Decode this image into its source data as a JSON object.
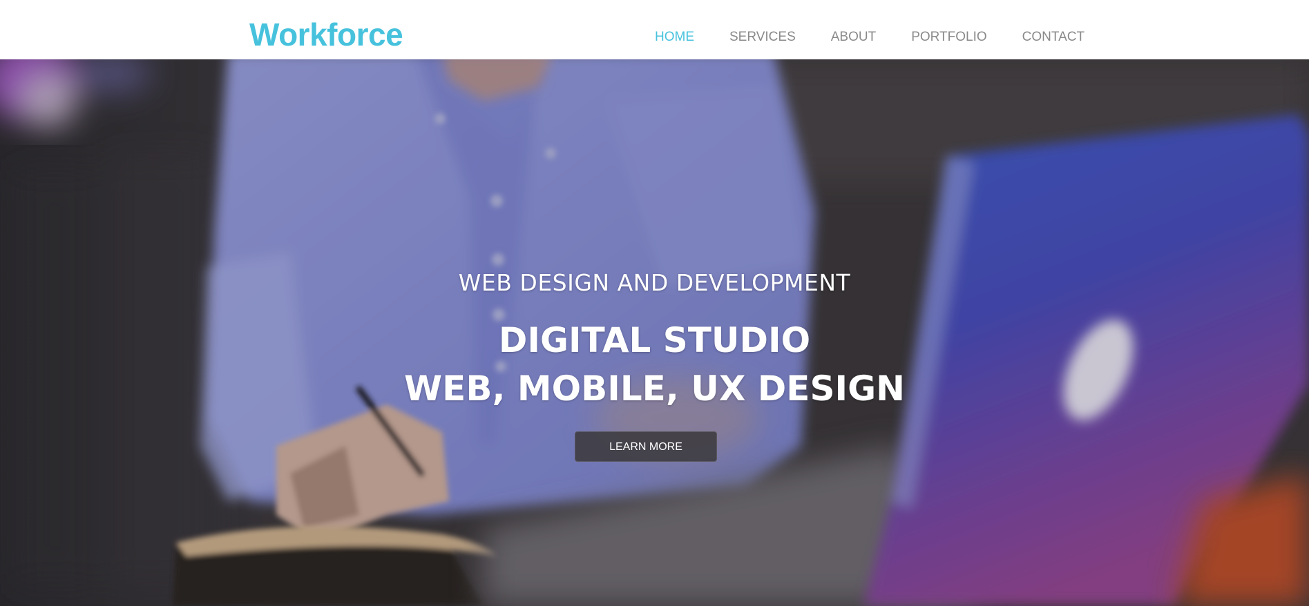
{
  "header": {
    "logo": "Workforce",
    "nav": [
      {
        "label": "HOME",
        "active": true
      },
      {
        "label": "SERVICES",
        "active": false
      },
      {
        "label": "ABOUT",
        "active": false
      },
      {
        "label": "PORTFOLIO",
        "active": false
      },
      {
        "label": "CONTACT",
        "active": false
      }
    ]
  },
  "hero": {
    "kicker": "WEB DESIGN AND DEVELOPMENT",
    "title": "DIGITAL STUDIO",
    "subtitle": "WEB, MOBILE, UX DESIGN",
    "cta_label": "LEARN MORE",
    "background_image": "blurred photo of a person in a light blue shirt writing in a notebook next to an open laptop"
  },
  "colors": {
    "accent": "#47c2dd",
    "nav_text": "#8a8a8a",
    "header_bg": "#ffffff",
    "hero_text": "#ffffff",
    "button_bg": "#3c3a3e"
  }
}
